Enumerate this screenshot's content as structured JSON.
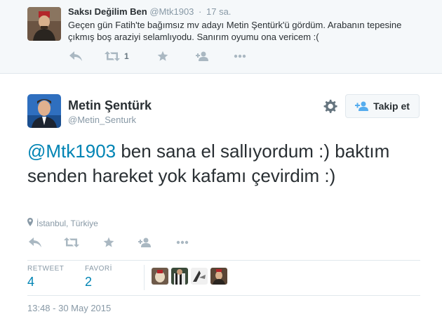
{
  "parent_tweet": {
    "name": "Saksı Değilim Ben",
    "handle": "@Mtk1903",
    "separator": "·",
    "time": "17 sa.",
    "text": "Geçen gün Fatih'te bağımsız mv adayı Metin Şentürk'ü gördüm. Arabanın tepesine çıkmış boş araziyi selamlıyodu. Sanırım oyumu ona vericem :(",
    "retweet_count": "1",
    "icons": [
      "reply-icon",
      "retweet-icon",
      "favorite-icon",
      "follow-icon",
      "more-icon"
    ]
  },
  "main_tweet": {
    "name": "Metin Şentürk",
    "handle": "@Metin_Senturk",
    "follow_label": "Takip et",
    "mention": "@Mtk1903",
    "text": " ben sana el sallıyordum :) baktım senden hareket yok kafamı çevirdim :)",
    "location": "İstanbul, Türkiye",
    "stats": {
      "retweet_label": "RETWEET",
      "retweet_count": "4",
      "favorite_label": "FAVORİ",
      "favorite_count": "2"
    },
    "favorited_by_count": 4,
    "timestamp": "13:48 - 30 May 2015"
  },
  "colors": {
    "link": "#0084b4",
    "muted": "#8899a6",
    "icon": "#aab8c2",
    "text": "#292f33",
    "parent_bg": "#f5f8fa",
    "border": "#e1e8ed"
  }
}
